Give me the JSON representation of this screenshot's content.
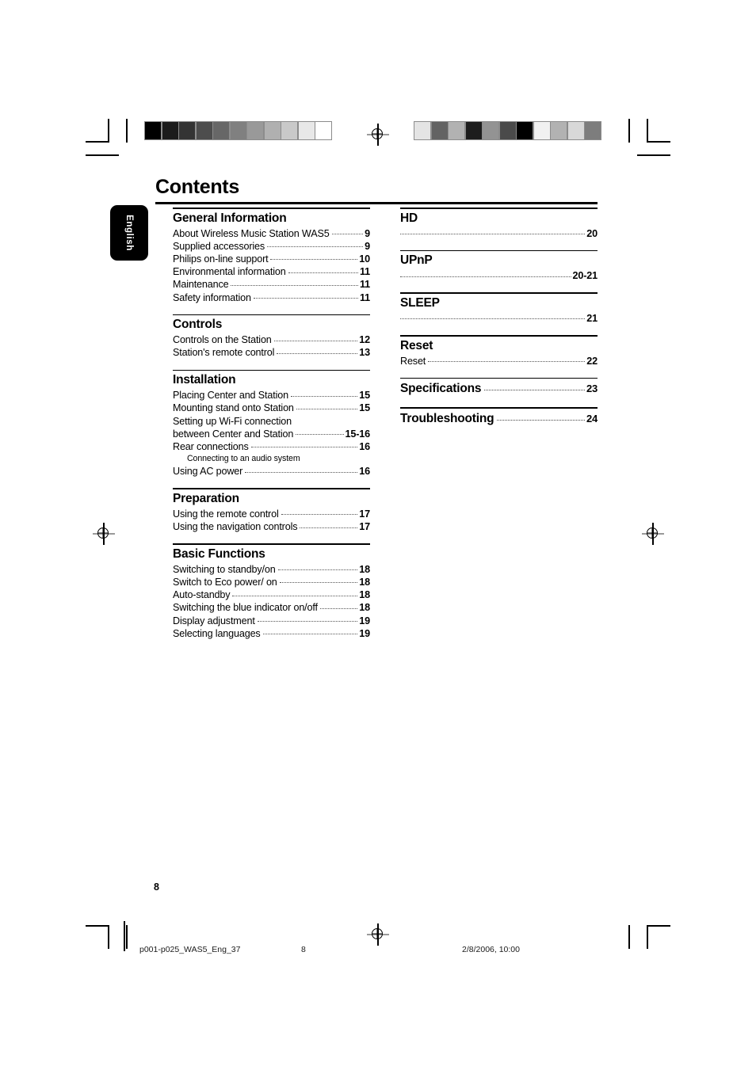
{
  "page": {
    "title": "Contents",
    "folio": "8",
    "language_tab": "English"
  },
  "footer": {
    "filename": "p001-p025_WAS5_Eng_37",
    "page": "8",
    "timestamp": "2/8/2006, 10:00"
  },
  "left_column": [
    {
      "heading": "General Information",
      "entries": [
        {
          "text": "About  Wireless Music Station WAS5",
          "page": "9"
        },
        {
          "text": "Supplied accessories",
          "page": "9"
        },
        {
          "text": "Philips on-line support",
          "page": "10"
        },
        {
          "text": "Environmental information",
          "page": "11"
        },
        {
          "text": "Maintenance",
          "page": "11"
        },
        {
          "text": "Safety information",
          "page": "11"
        }
      ]
    },
    {
      "heading": "Controls",
      "entries": [
        {
          "text": "Controls on the Station",
          "page": "12"
        },
        {
          "text": "Station's remote control",
          "page": "13"
        }
      ]
    },
    {
      "heading": "Installation",
      "entries": [
        {
          "text": "Placing Center and Station",
          "page": "15"
        },
        {
          "text": "Mounting stand onto Station",
          "page": "15"
        },
        {
          "text": "Setting up Wi-Fi connection",
          "page": "",
          "style": "plain"
        },
        {
          "text": "between Center and Station",
          "page": "15-16"
        },
        {
          "text": "Rear connections",
          "page": "16"
        },
        {
          "text": "Connecting to an audio system",
          "page": "",
          "style": "sub"
        },
        {
          "text": "Using AC power",
          "page": "16"
        }
      ]
    },
    {
      "heading": "Preparation",
      "entries": [
        {
          "text": "Using the remote control",
          "page": "17"
        },
        {
          "text": "Using the navigation controls",
          "page": "17"
        }
      ]
    },
    {
      "heading": "Basic Functions",
      "entries": [
        {
          "text": "Switching to standby/on",
          "page": "18"
        },
        {
          "text": "Switch to Eco power/ on",
          "page": "18"
        },
        {
          "text": "Auto-standby",
          "page": "18"
        },
        {
          "text": "Switching the blue indicator on/off",
          "page": "18"
        },
        {
          "text": "Display adjustment",
          "page": "19"
        },
        {
          "text": "Selecting languages",
          "page": "19"
        }
      ]
    }
  ],
  "right_column": [
    {
      "heading": "HD",
      "heading_page": "",
      "entries": [
        {
          "text": "",
          "page": "20",
          "style": "blank-title"
        }
      ]
    },
    {
      "heading": "UPnP",
      "heading_page": "",
      "entries": [
        {
          "text": "",
          "page": "20-21",
          "style": "blank-title"
        }
      ]
    },
    {
      "heading": "SLEEP",
      "heading_page": "",
      "entries": [
        {
          "text": "",
          "page": "21",
          "style": "blank-title"
        }
      ]
    },
    {
      "heading": "Reset",
      "heading_page": "",
      "entries": [
        {
          "text": "Reset",
          "page": "22"
        }
      ]
    },
    {
      "heading": "Specifications",
      "heading_page": "23",
      "entries": []
    },
    {
      "heading": "Troubleshooting",
      "heading_page": "24",
      "entries": []
    }
  ],
  "calibration": {
    "left_bar": [
      "#000000",
      "#1c1c1c",
      "#343434",
      "#4d4d4d",
      "#676767",
      "#808080",
      "#999999",
      "#b0b0b0",
      "#c9c9c9",
      "#e8e8e8",
      "#ffffff"
    ],
    "right_bar": [
      "#e4e4e4",
      "#636363",
      "#b2b2b2",
      "#1d1d1d",
      "#939393",
      "#4a4a4a",
      "#000000",
      "#f1f1f1",
      "#b2b2b2",
      "#d8d8d8",
      "#7d7d7d"
    ]
  }
}
